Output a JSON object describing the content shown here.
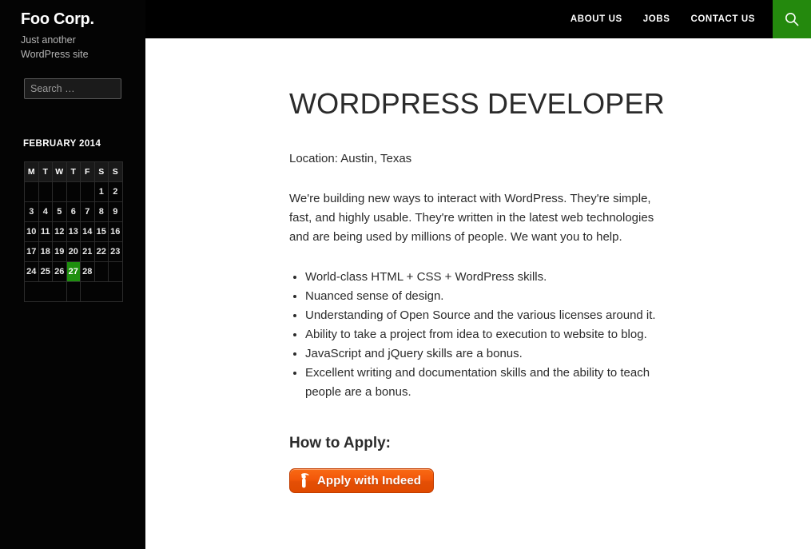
{
  "site": {
    "title": "Foo Corp.",
    "description": "Just another WordPress site"
  },
  "header": {
    "nav_items": [
      {
        "label": "ABOUT US"
      },
      {
        "label": "JOBS"
      },
      {
        "label": "CONTACT US"
      }
    ],
    "search_toggle_icon": "search-icon"
  },
  "sidebar": {
    "search": {
      "placeholder": "Search …",
      "value": ""
    },
    "calendar": {
      "caption": "FEBRUARY 2014",
      "weekday_headers": [
        "M",
        "T",
        "W",
        "T",
        "F",
        "S",
        "S"
      ],
      "weeks": [
        [
          "",
          "",
          "",
          "",
          "",
          "1",
          "2"
        ],
        [
          "3",
          "4",
          "5",
          "6",
          "7",
          "8",
          "9"
        ],
        [
          "10",
          "11",
          "12",
          "13",
          "14",
          "15",
          "16"
        ],
        [
          "17",
          "18",
          "19",
          "20",
          "21",
          "22",
          "23"
        ],
        [
          "24",
          "25",
          "26",
          "27",
          "28",
          "",
          ""
        ]
      ],
      "today": "27",
      "prev_label": "",
      "next_label": ""
    }
  },
  "main": {
    "entry_title": "WordPress Developer",
    "location_line": "Location: Austin, Texas",
    "intro_paragraph": "We're building new ways to interact with WordPress. They're simple, fast, and highly usable. They're written in the latest web technologies and are being used by millions of people. We want you to help.",
    "requirements": [
      "World-class HTML + CSS + WordPress skills.",
      "Nuanced sense of design.",
      "Understanding of Open Source and the various licenses around it.",
      "Ability to take a project from idea to execution to website to blog.",
      "JavaScript and jQuery skills are a bonus.",
      "Excellent writing and documentation skills and the ability to teach people are a bonus."
    ],
    "how_to_apply_heading": "How to Apply:",
    "apply_button": {
      "label": "Apply with Indeed",
      "icon": "indeed-i-icon"
    }
  },
  "colors": {
    "accent_green": "#24890d",
    "sidebar_black": "#040404",
    "today_green": "#1e8f0e",
    "indeed_orange": "#f2570a",
    "text_dark": "#2b2b2b"
  }
}
